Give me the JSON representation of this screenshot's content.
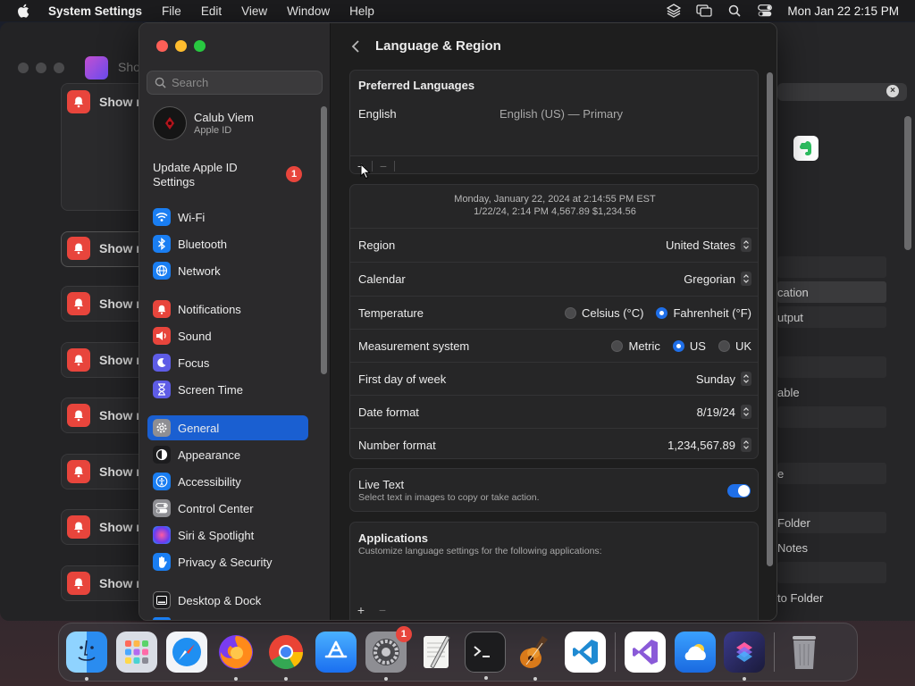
{
  "menubar": {
    "app_name": "System Settings",
    "items": [
      "File",
      "Edit",
      "View",
      "Window",
      "Help"
    ],
    "clock": "Mon Jan 22  2:15 PM"
  },
  "background_left": {
    "title": "Sho",
    "rows": [
      "Show n",
      "Show n",
      "Show n",
      "Show n",
      "Show n",
      "Show n",
      "Show n",
      "Show n"
    ]
  },
  "background_right": {
    "rows": [
      "cation",
      "utput",
      "able",
      "e",
      "Folder",
      "Notes",
      "to Folder"
    ]
  },
  "sidebar": {
    "search_placeholder": "Search",
    "profile": {
      "name": "Calub Viem",
      "sub": "Apple ID"
    },
    "update": {
      "label": "Update Apple ID Settings",
      "badge": "1"
    },
    "items": [
      {
        "label": "Wi-Fi",
        "icon": "wifi-icon",
        "color": "#1a7ef2"
      },
      {
        "label": "Bluetooth",
        "icon": "bluetooth-icon",
        "color": "#1a7ef2"
      },
      {
        "label": "Network",
        "icon": "globe-icon",
        "color": "#1a7ef2"
      },
      {
        "label": "Notifications",
        "icon": "bell-icon",
        "color": "#e8453c"
      },
      {
        "label": "Sound",
        "icon": "speaker-icon",
        "color": "#e8453c"
      },
      {
        "label": "Focus",
        "icon": "moon-icon",
        "color": "#5e5ce6"
      },
      {
        "label": "Screen Time",
        "icon": "hourglass-icon",
        "color": "#5e5ce6"
      },
      {
        "label": "General",
        "icon": "gear-icon",
        "color": "#8e8e93"
      },
      {
        "label": "Appearance",
        "icon": "appearance-icon",
        "color": "#1c1c1e"
      },
      {
        "label": "Accessibility",
        "icon": "accessibility-icon",
        "color": "#1a7ef2"
      },
      {
        "label": "Control Center",
        "icon": "control-center-icon",
        "color": "#8e8e93"
      },
      {
        "label": "Siri & Spotlight",
        "icon": "siri-icon",
        "color": "#c040d0"
      },
      {
        "label": "Privacy & Security",
        "icon": "hand-icon",
        "color": "#1a7ef2"
      },
      {
        "label": "Desktop & Dock",
        "icon": "dock-icon",
        "color": "#1c1c1e"
      }
    ],
    "selected": "General"
  },
  "content": {
    "title": "Language & Region",
    "preferred": {
      "heading": "Preferred Languages",
      "language": "English",
      "language_detail": "English (US) — Primary"
    },
    "sample": {
      "line1": "Monday, January 22, 2024 at 2:14:55 PM EST",
      "line2": "1/22/24, 2:14 PM     4,567.89     $1,234.56"
    },
    "region": {
      "label": "Region",
      "value": "United States"
    },
    "calendar": {
      "label": "Calendar",
      "value": "Gregorian"
    },
    "temperature": {
      "label": "Temperature",
      "options": [
        "Celsius (°C)",
        "Fahrenheit (°F)"
      ],
      "selected": "Fahrenheit (°F)"
    },
    "measurement": {
      "label": "Measurement system",
      "options": [
        "Metric",
        "US",
        "UK"
      ],
      "selected": "US"
    },
    "first_day": {
      "label": "First day of week",
      "value": "Sunday"
    },
    "date_format": {
      "label": "Date format",
      "value": "8/19/24"
    },
    "number_format": {
      "label": "Number format",
      "value": "1,234,567.89"
    },
    "live_text": {
      "title": "Live Text",
      "subtitle": "Select text in images to copy or take action.",
      "enabled": true
    },
    "applications": {
      "title": "Applications",
      "subtitle": "Customize language settings for the following applications:"
    },
    "add_symbol": "+",
    "remove_symbol": "−"
  },
  "dock": {
    "apps": [
      {
        "name": "Finder",
        "icon": "finder-icon",
        "running": true
      },
      {
        "name": "Launchpad",
        "icon": "launchpad-icon",
        "running": false
      },
      {
        "name": "Safari",
        "icon": "safari-icon",
        "running": false
      },
      {
        "name": "Firefox",
        "icon": "firefox-icon",
        "running": true
      },
      {
        "name": "Chrome",
        "icon": "chrome-icon",
        "running": true
      },
      {
        "name": "App Store",
        "icon": "app-store-icon",
        "running": false
      },
      {
        "name": "System Settings",
        "icon": "system-settings-icon",
        "running": true,
        "badge": "1"
      },
      {
        "name": "TextEdit",
        "icon": "textedit-icon",
        "running": false
      },
      {
        "name": "Terminal",
        "icon": "terminal-icon",
        "running": true
      },
      {
        "name": "GarageBand",
        "icon": "garageband-icon",
        "running": true
      },
      {
        "name": "VS Code",
        "icon": "vscode-icon",
        "running": false
      },
      {
        "name": "Visual Studio",
        "icon": "visual-studio-icon",
        "running": false
      },
      {
        "name": "Weather",
        "icon": "weather-icon",
        "running": false
      },
      {
        "name": "Shortcuts",
        "icon": "shortcuts-icon",
        "running": true
      },
      {
        "name": "Trash",
        "icon": "trash-icon",
        "running": false
      }
    ]
  }
}
